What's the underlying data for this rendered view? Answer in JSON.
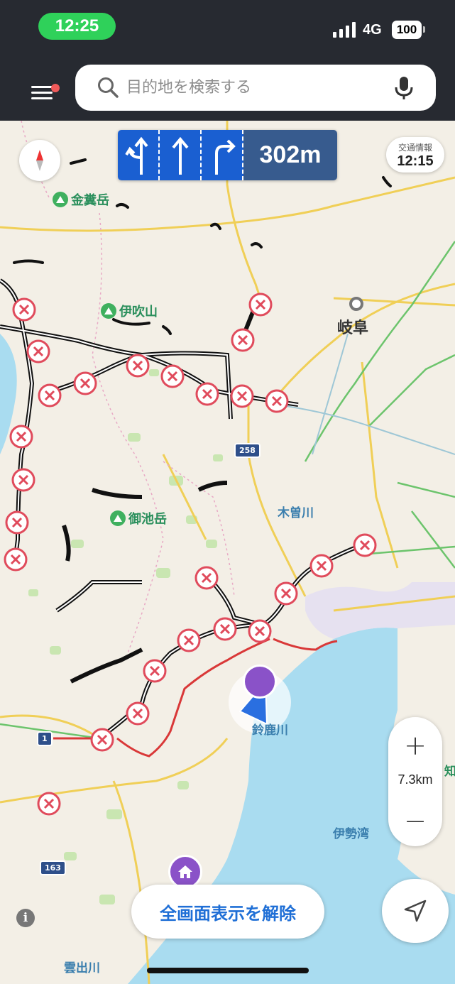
{
  "status_bar": {
    "time": "12:25",
    "network": "4G",
    "battery": "100"
  },
  "search": {
    "placeholder": "目的地を検索する"
  },
  "guidance": {
    "lanes": [
      "straight-or-left-arrow-icon",
      "straight-arrow-icon",
      "turn-right-arrow-icon"
    ],
    "distance": "302m"
  },
  "traffic": {
    "label": "交通情報",
    "time": "12:15"
  },
  "map": {
    "labels": {
      "mountains": [
        "金糞岳",
        "伊吹山",
        "御池岳"
      ],
      "city": "岐阜",
      "rivers": [
        "木曽川",
        "鈴鹿川",
        "雲出川"
      ],
      "bay": "伊勢湾",
      "partial": "知"
    },
    "route_shields": [
      "258",
      "1",
      "163"
    ]
  },
  "zoom": {
    "scale": "7.3km",
    "plus": "+",
    "minus": "−"
  },
  "buttons": {
    "exit_fullscreen": "全画面表示を解除",
    "info": "i"
  },
  "colors": {
    "accent": "#1f6fd6",
    "lane_bg": "#1a5fd1",
    "route_red": "#d93838",
    "status_green": "#2fd15a"
  }
}
